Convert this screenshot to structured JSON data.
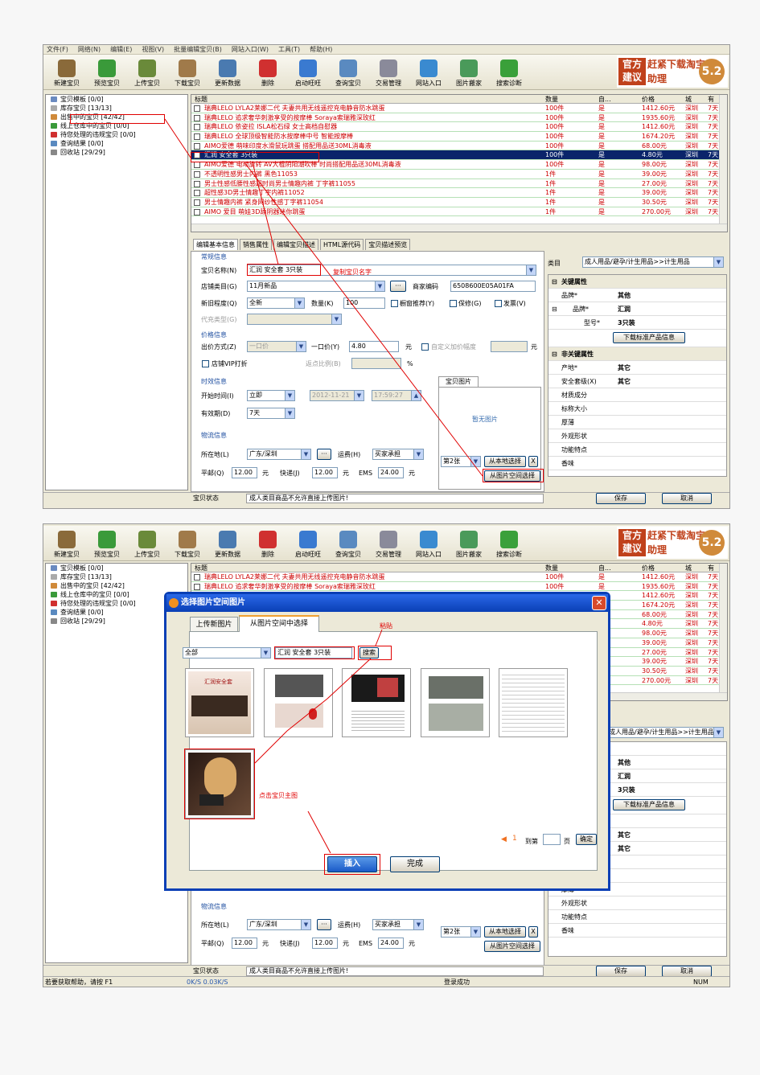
{
  "menu": [
    "文件(F)",
    "网络(N)",
    "编辑(E)",
    "视图(V)",
    "批量编辑宝贝(B)",
    "网站入口(W)",
    "工具(T)",
    "帮助(H)"
  ],
  "toolbar": [
    {
      "label": "新建宝贝",
      "icon": "new-item-icon",
      "color": "#8a6a3a"
    },
    {
      "label": "预览宝贝",
      "icon": "preview-eye-icon",
      "color": "#3a9a3a"
    },
    {
      "label": "上传宝贝",
      "icon": "upload-box-icon",
      "color": "#6a8a3a"
    },
    {
      "label": "下载宝贝",
      "icon": "download-box-icon",
      "color": "#a07a4a"
    },
    {
      "label": "更新数据",
      "icon": "chart-icon",
      "color": "#4a7ab0"
    },
    {
      "label": "删除",
      "icon": "delete-icon",
      "color": "#d03030"
    },
    {
      "label": "启动旺旺",
      "icon": "wangwang-icon",
      "color": "#3a7ad0"
    },
    {
      "label": "查询宝贝",
      "icon": "magnifier-icon",
      "color": "#5a8ac0"
    },
    {
      "label": "交易管理",
      "icon": "gear-icon",
      "color": "#8a8a9a"
    },
    {
      "label": "网站入口",
      "icon": "globe-icon",
      "color": "#3a8ad0"
    },
    {
      "label": "图片搬家",
      "icon": "picture-icon",
      "color": "#4a9a5a"
    },
    {
      "label": "搜索诊断",
      "icon": "check-icon",
      "color": "#3aa03a"
    }
  ],
  "brand": {
    "left_text": "官方建议",
    "mid_text": "赶紧下载淘宝助理",
    "version": "5.2"
  },
  "tree": [
    {
      "label": "宝贝模板 [0/0]",
      "color": "#6a8ac0"
    },
    {
      "label": "库存宝贝 [13/13]",
      "color": "#aaa"
    },
    {
      "label": "出售中的宝贝 [42/42]",
      "color": "#d08a3a"
    },
    {
      "label": "线上仓库中的宝贝 [0/0]",
      "color": "#3a9a3a"
    },
    {
      "label": "待您处理的违规宝贝 [0/0]",
      "color": "#d03030"
    },
    {
      "label": "查询结果 [0/0]",
      "color": "#5a8ac0"
    },
    {
      "label": "回收站 [29/29]",
      "color": "#888"
    }
  ],
  "grid": {
    "headers": [
      "标题",
      "数量",
      "自...",
      "价格",
      "城",
      "有"
    ],
    "rows": [
      {
        "title": "瑞典LELO LYLA2莱娜二代 夫妻共用无线遥控充电静音防水跳蛋",
        "qty": "100件",
        "auto": "是",
        "price": "1412.60元",
        "city": "深圳",
        "valid": "7天"
      },
      {
        "title": "瑞典LELO 追求奢华刺激享受的按摩棒 Soraya索瑞雅深玫红",
        "qty": "100件",
        "auto": "是",
        "price": "1935.60元",
        "city": "深圳",
        "valid": "7天"
      },
      {
        "title": "瑞典LELO 依姿拉 ISLA松石绿 女士高档自慰器",
        "qty": "100件",
        "auto": "是",
        "price": "1412.60元",
        "city": "深圳",
        "valid": "7天"
      },
      {
        "title": "瑞典LELO 全球顶级智能防水按摩棒中号 智能按摩棒",
        "qty": "100件",
        "auto": "是",
        "price": "1674.20元",
        "city": "深圳",
        "valid": "7天"
      },
      {
        "title": "AIMO爱德 萌味印度水滑鼠玩跳蛋 搭配用品送30ML消毒液",
        "qty": "100件",
        "auto": "是",
        "price": "68.00元",
        "city": "深圳",
        "valid": "7天"
      },
      {
        "title": "汇润 安全套 3只装",
        "qty": "100件",
        "auto": "是",
        "price": "4.80元",
        "city": "深圳",
        "valid": "7天"
      },
      {
        "title": "AIMO爱德 电动旋转 AV大棍阴阳潮吹棒 时尚搭配用品送30ML消毒液",
        "qty": "100件",
        "auto": "是",
        "price": "98.00元",
        "city": "深圳",
        "valid": "7天"
      },
      {
        "title": "不透明性感男士内裤 黑色11053",
        "qty": "1件",
        "auto": "是",
        "price": "39.00元",
        "city": "深圳",
        "valid": "7天"
      },
      {
        "title": "男士性感低腰性感超时尚男士情趣内裤 丁字裤11055",
        "qty": "1件",
        "auto": "是",
        "price": "27.00元",
        "city": "深圳",
        "valid": "7天"
      },
      {
        "title": "超性感3D男士情趣丁字内裤11052",
        "qty": "1件",
        "auto": "是",
        "price": "39.00元",
        "city": "深圳",
        "valid": "7天"
      },
      {
        "title": "男士情趣内裤 紧身网纱性感丁字裤11054",
        "qty": "1件",
        "auto": "是",
        "price": "30.50元",
        "city": "深圳",
        "valid": "7天"
      },
      {
        "title": "AIMO 爱目 萌娃3D舔阴器迷你跳蛋",
        "qty": "1件",
        "auto": "是",
        "price": "270.00元",
        "city": "深圳",
        "valid": "7天"
      }
    ]
  },
  "tabs": [
    "编辑基本信息",
    "销售属性",
    "编辑宝贝描述",
    "HTML源代码",
    "宝贝描述预览"
  ],
  "form": {
    "section_common": "常规信息",
    "name_label": "宝贝名称(N)",
    "name_value": "汇润 安全套 3只装",
    "category_label": "店铺类目(G)",
    "category_value": "11月新品",
    "code_label": "商家编码",
    "code_value": "6508600E05A01FA",
    "condition_label": "新旧程度(Q)",
    "condition_value": "全新",
    "qty_label": "数量(K)",
    "qty_value": "100",
    "window_label": "橱窗推荐(Y)",
    "warranty_label": "保修(G)",
    "invoice_label": "发票(V)",
    "agent_label": "代充类型(G)",
    "section_price": "价格信息",
    "price_method_label": "出价方式(Z)",
    "price_method_value": "一口价",
    "fixed_price_label": "一口价(Y)",
    "fixed_price_value": "4.80",
    "yuan": "元",
    "custom_label": "自定义加价幅度",
    "vip_label": "店铺VIP打折",
    "rebate_label": "返点比例(B)",
    "percent": "%",
    "section_time": "时效信息",
    "start_label": "开始时间(I)",
    "start_value": "立即",
    "date_value": "2012-11-21",
    "time_value": "17:59:27",
    "period_label": "有效期(D)",
    "period_value": "7天",
    "section_ship": "物流信息",
    "location_label": "所在地(L)",
    "location_value": "广东/深圳",
    "freight_label": "运费(H)",
    "freight_value": "买家承担",
    "post_label": "平邮(Q)",
    "post_value": "12.00",
    "express_label": "快递(J)",
    "express_value": "12.00",
    "ems_label": "EMS",
    "ems_value": "24.00",
    "pic_tab": "宝贝图片",
    "no_pic": "暂无图片",
    "pic_no": "第2张",
    "local_pick": "从本地选择",
    "space_pick": "从图片空间选择",
    "remove": "X"
  },
  "props": {
    "category_label": "类目",
    "category_value": "成人用品/避孕/计生用品>>计生用品",
    "key_section": "关键属性",
    "brand_label": "品牌*",
    "brand_value": "其他",
    "pinming_label": "品牌*",
    "pinming_value": "汇润",
    "model_label": "型号*",
    "model_value": "3只装",
    "download_btn": "下载标准产品信息",
    "nonkey_section": "非关键属性",
    "origin_label": "产地*",
    "origin_value": "其它",
    "safety_label": "安全套级(X)",
    "safety_value": "其它",
    "material_label": "材质成分",
    "size_label": "标称大小",
    "thickness_label": "厚薄",
    "shape_label": "外观形状",
    "feature_label": "功能特点",
    "flavor_label": "香味"
  },
  "status1": {
    "label": "宝贝状态",
    "msg": "成人类目商品不允许直接上传图片!",
    "save": "保存",
    "cancel": "取消"
  },
  "annot1": {
    "copy_name": "复制宝贝名字"
  },
  "dialog": {
    "title": "选择图片空间图片",
    "tab_upload": "上传新图片",
    "tab_space": "从图片空间中选择",
    "filter": "全部",
    "search_value": "汇润 安全套 3只装",
    "search_btn": "搜索",
    "paste": "粘贴",
    "click_main": "点击宝贝主图",
    "page_num": "1",
    "goto": "到第",
    "page": "页",
    "confirm": "确定",
    "insert": "插入",
    "done": "完成",
    "thumb_text": "汇润安全套"
  },
  "status2": {
    "help": "若要获取帮助，请按 F1",
    "speed": "0K/S  0.03K/S",
    "login": "登录成功",
    "num": "NUM"
  }
}
